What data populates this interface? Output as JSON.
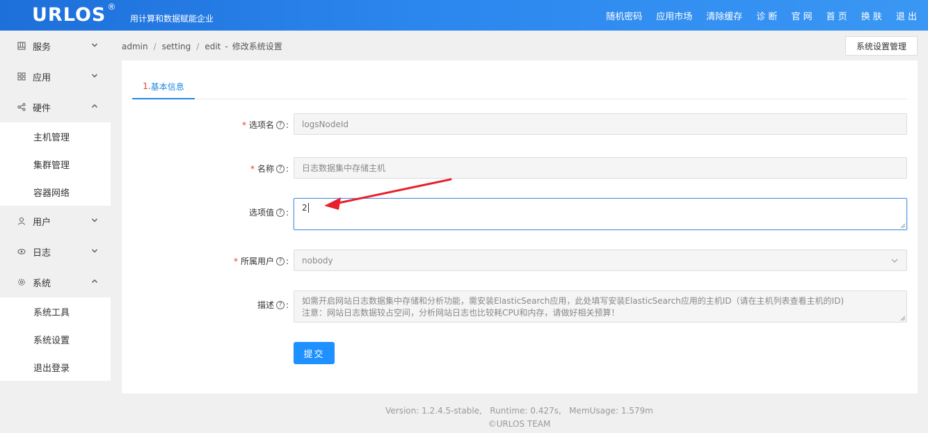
{
  "header": {
    "logo": "URLOS",
    "logo_mark": "®",
    "slogan": "用计算和数据赋能企业",
    "nav": [
      "随机密码",
      "应用市场",
      "清除缓存",
      "诊 断",
      "官 网",
      "首 页",
      "换 肤",
      "退 出"
    ]
  },
  "sidebar": {
    "items": [
      {
        "label": "服务",
        "icon": "grid-icon",
        "expanded": false,
        "children": []
      },
      {
        "label": "应用",
        "icon": "apps-icon",
        "expanded": false,
        "children": []
      },
      {
        "label": "硬件",
        "icon": "share-icon",
        "expanded": true,
        "children": [
          "主机管理",
          "集群管理",
          "容器网络"
        ]
      },
      {
        "label": "用户",
        "icon": "user-icon",
        "expanded": false,
        "children": []
      },
      {
        "label": "日志",
        "icon": "eye-icon",
        "expanded": false,
        "children": []
      },
      {
        "label": "系统",
        "icon": "gear-icon",
        "expanded": true,
        "children": [
          "系统工具",
          "系统设置",
          "退出登录"
        ]
      }
    ]
  },
  "breadcrumb": {
    "parts": [
      "admin",
      "setting",
      "edit"
    ],
    "title": "修改系统设置"
  },
  "mgmt_button": "系统设置管理",
  "tab": {
    "num": "1.",
    "label": "基本信息"
  },
  "form": {
    "option_name": {
      "label": "选项名",
      "value": "logsNodeId"
    },
    "name": {
      "label": "名称",
      "value": "日志数据集中存储主机"
    },
    "option_value": {
      "label": "选项值",
      "value": "2"
    },
    "owner": {
      "label": "所属用户",
      "value": "nobody"
    },
    "description": {
      "label": "描述",
      "line1": "如需开启网站日志数据集中存储和分析功能，需安装ElasticSearch应用，此处填写安装ElasticSearch应用的主机ID（请在主机列表查看主机的ID)",
      "line2": "注意：网站日志数据较占空间，分析网站日志也比较耗CPU和内存，请做好相关预算！"
    },
    "submit": "提交"
  },
  "footer": {
    "line1": "Version: 1.2.4.5-stable,   Runtime: 0.427s,   MemUsage: 1.579m",
    "line2": "©URLOS TEAM"
  },
  "colors": {
    "accent": "#1e90ff",
    "required": "#e53935",
    "annotation": "#e8202a"
  }
}
